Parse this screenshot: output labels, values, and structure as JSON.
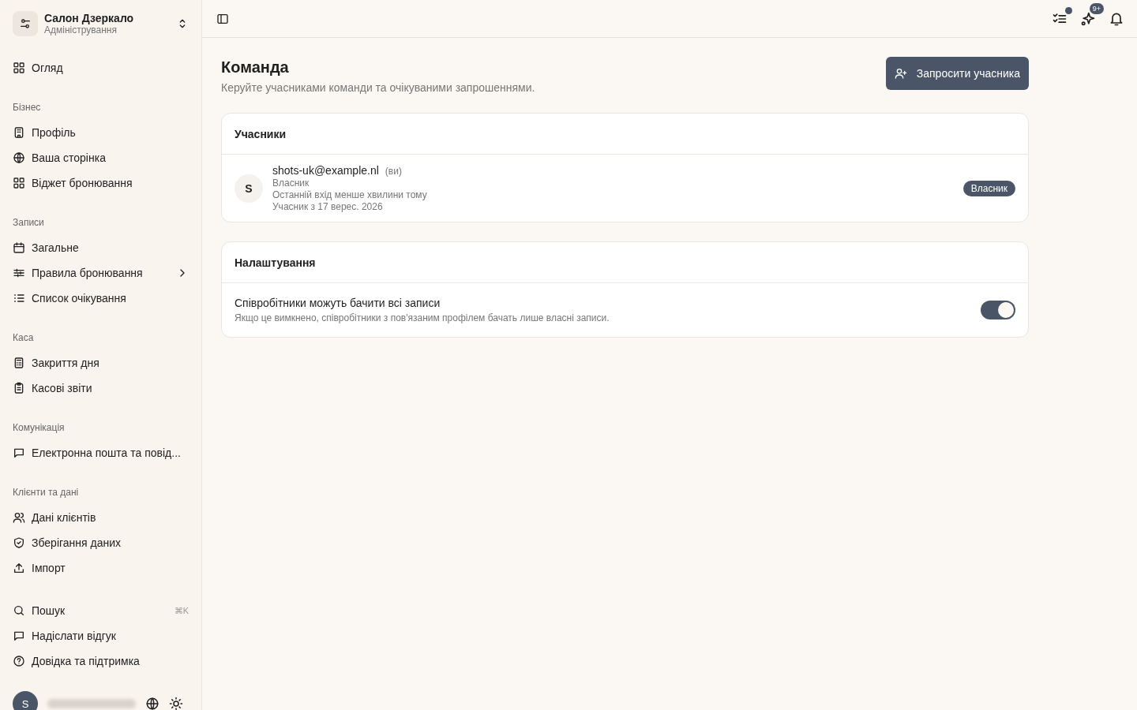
{
  "sidebar": {
    "workspace": {
      "title": "Салон Дзеркало",
      "subtitle": "Адміністрування"
    },
    "sections": [
      {
        "items": [
          {
            "label": "Огляд",
            "selected": false
          }
        ]
      },
      {
        "heading": "Бізнес",
        "items": [
          {
            "label": "Профіль",
            "selected": false
          },
          {
            "label": "Ваша сторінка",
            "selected": false
          },
          {
            "label": "Віджет бронювання",
            "selected": false
          }
        ]
      },
      {
        "heading": "Записи",
        "items": [
          {
            "label": "Загальне",
            "selected": false
          },
          {
            "label": "Правила бронювання",
            "selected": false,
            "expandable": true
          },
          {
            "label": "Список очікування",
            "selected": false
          }
        ]
      },
      {
        "heading": "Каса",
        "items": [
          {
            "label": "Закриття дня",
            "selected": false
          },
          {
            "label": "Касові звіти",
            "selected": false
          }
        ]
      },
      {
        "heading": "Комунікація",
        "items": [
          {
            "label": "Електронна пошта та повід...",
            "selected": false
          }
        ]
      },
      {
        "heading": "Клієнти та дані",
        "items": [
          {
            "label": "Дані клієнтів",
            "selected": false
          },
          {
            "label": "Зберігання даних",
            "selected": false
          },
          {
            "label": "Імпорт",
            "selected": false
          }
        ]
      }
    ],
    "bottom_items": [
      {
        "label": "Пошук",
        "shortcut": "⌘K"
      },
      {
        "label": "Надіслати відгук"
      },
      {
        "label": "Довідка та підтримка"
      }
    ],
    "user": {
      "avatar": "S"
    }
  },
  "topbar": {
    "tasks_dot": true,
    "whats_new_badge": "9+"
  },
  "page": {
    "title": "Команда",
    "description": "Керуйте учасниками команди та очікуваними запрошеннями.",
    "invite_button": "Запросити учасника"
  },
  "members": {
    "title": "Учасники",
    "rows": [
      {
        "avatar": "S",
        "email": "shots-uk@example.nl",
        "you": "(ви)",
        "role": "Власник",
        "last_login": "Останній вхід менше хвилини тому",
        "member_since": "Учасник з 17 верес. 2026",
        "badge": "Власник"
      }
    ]
  },
  "settings": {
    "title": "Налаштування",
    "items": [
      {
        "label": "Співробітники можуть бачити всі записи",
        "description": "Якщо це вимкнено, співробітники з пов'язаним профілем бачать лише власні записи.",
        "on": true
      }
    ]
  }
}
